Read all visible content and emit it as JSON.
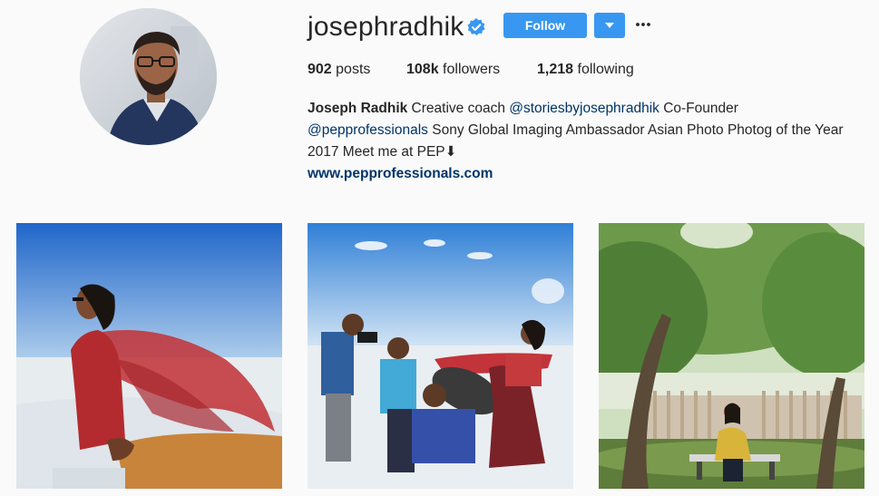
{
  "profile": {
    "username": "josephradhik",
    "verified": true,
    "follow_label": "Follow",
    "more_label": "•••",
    "stats": {
      "posts_count": "902",
      "posts_label": "posts",
      "followers_count": "108k",
      "followers_label": "followers",
      "following_count": "1,218",
      "following_label": "following"
    },
    "bio": {
      "full_name": "Joseph Radhik",
      "text_1": " Creative coach ",
      "mention_1": "@storiesbyjosephradhik",
      "text_2": " Co-Founder ",
      "mention_2": "@pepprofessionals",
      "text_3": " Sony Global Imaging Ambassador Asian Photo Photog of the Year 2017 Meet me at PEP⬇",
      "website": "www.pepprofessionals.com"
    }
  },
  "posts": [
    {
      "subject": "bride-in-desert-photo"
    },
    {
      "subject": "photoshoot-behind-scenes-photo"
    },
    {
      "subject": "woman-under-trees-photo"
    }
  ],
  "colors": {
    "accent": "#3897f0",
    "link": "#003569",
    "text": "#262626",
    "background": "#fafafa"
  }
}
